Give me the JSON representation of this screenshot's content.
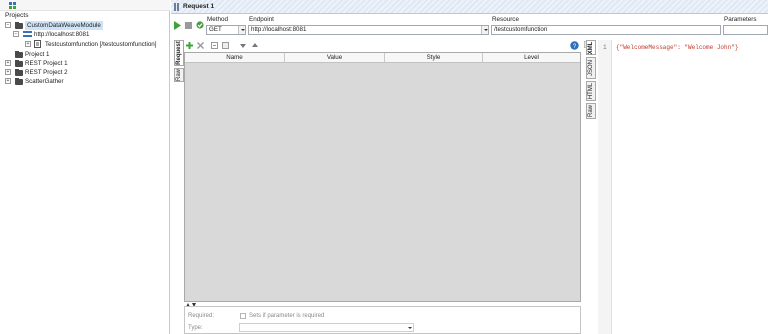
{
  "navigator": {
    "title": "Projects",
    "tree": [
      {
        "label": "CustomDataWeaveModule",
        "selected": true
      },
      {
        "label": "http://localhost:8081"
      },
      {
        "label": "Testcustomfunction [/testcustomfunction]"
      },
      {
        "label": "Project 1"
      },
      {
        "label": "REST Project 1"
      },
      {
        "label": "REST Project 2"
      },
      {
        "label": "ScatterGather"
      }
    ]
  },
  "request": {
    "title": "Request 1",
    "method_label": "Method",
    "method_value": "GET",
    "endpoint_label": "Endpoint",
    "endpoint_value": "http://localhost:8081",
    "resource_label": "Resource",
    "resource_value": "/testcustomfunction",
    "parameters_label": "Parameters",
    "tabs": [
      "Request",
      "Raw"
    ],
    "table_columns": [
      "Name",
      "Value",
      "Style",
      "Level"
    ],
    "required_label": "Required:",
    "required_hint": "Sets if parameter is required",
    "type_label": "Type:"
  },
  "response": {
    "tabs": [
      "XML",
      "JSON",
      "HTML",
      "Raw"
    ],
    "line_number": "1",
    "content": "{\"WelcomeMessage\": \"Welcome John\"}"
  },
  "colors": {
    "accent_green": "#3ea33a",
    "selection": "#cfe3f7",
    "json_text": "#c0392b"
  }
}
